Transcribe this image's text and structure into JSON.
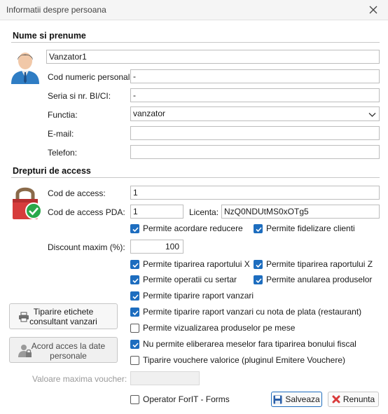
{
  "window": {
    "title": "Informatii despre persoana"
  },
  "personal": {
    "section_title": "Nume si prenume",
    "name_value": "Vanzator1",
    "cnp_label": "Cod numeric personal:",
    "cnp_value": "-",
    "id_label": "Seria si nr. BI/CI:",
    "id_value": "-",
    "function_label": "Functia:",
    "function_value": "vanzator",
    "email_label": "E-mail:",
    "email_value": "",
    "phone_label": "Telefon:",
    "phone_value": ""
  },
  "access": {
    "section_title": "Drepturi de access",
    "code_label": "Cod de access:",
    "code_value": "1",
    "pda_label": "Cod de access PDA:",
    "pda_value": "1",
    "license_label": "Licenta:",
    "license_value": "NzQ0NDUtMS0xOTg5",
    "discount_label": "Discount maxim (%):",
    "discount_value": "100",
    "voucher_label": "Valoare maxima voucher:",
    "voucher_value": ""
  },
  "checkboxes": {
    "reducere": {
      "label": "Permite acordare reducere",
      "checked": true
    },
    "fidelizare": {
      "label": "Permite fidelizare clienti",
      "checked": true
    },
    "raport_x": {
      "label": "Permite tiparirea raportului X",
      "checked": true
    },
    "raport_z": {
      "label": "Permite tiparirea raportului Z",
      "checked": true
    },
    "sertar": {
      "label": "Permite operatii cu sertar",
      "checked": true
    },
    "anulare": {
      "label": "Permite anularea produselor",
      "checked": true
    },
    "raport_vanzari": {
      "label": "Permite tiparire raport vanzari",
      "checked": true
    },
    "raport_nota": {
      "label": "Permite tiparire raport vanzari cu nota de plata (restaurant)",
      "checked": true
    },
    "vizualizare_mese": {
      "label": "Permite vizualizarea produselor pe mese",
      "checked": false
    },
    "eliberare_mese": {
      "label": "Nu permite eliberarea meselor fara tiparirea bonului fiscal",
      "checked": true
    },
    "vouchere": {
      "label": "Tiparire vouchere valorice (pluginul Emitere Vouchere)",
      "checked": false
    },
    "operator_forit": {
      "label": "Operator ForIT - Forms",
      "checked": false
    }
  },
  "buttons": {
    "print_labels_line1": "Tiparire etichete",
    "print_labels_line2": "consultant vanzari",
    "gdpr_line1": "Acord acces la date",
    "gdpr_line2": "personale",
    "save": "Salveaza",
    "cancel": "Renunta"
  },
  "colors": {
    "accent": "#1d6dbf",
    "cancel_red": "#d93a3a"
  }
}
